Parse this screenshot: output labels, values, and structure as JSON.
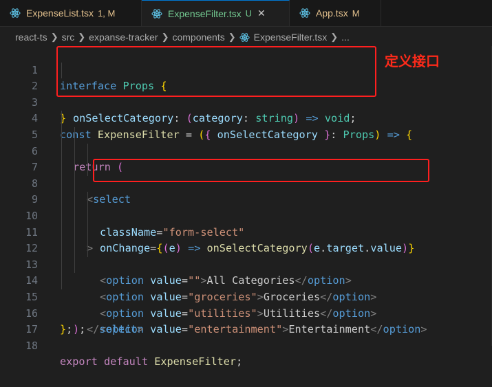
{
  "tabs": [
    {
      "name": "ExpenseList.tsx",
      "status": "1, M"
    },
    {
      "name": "ExpenseFilter.tsx",
      "status": "U",
      "close": "✕"
    },
    {
      "name": "App.tsx",
      "status": "M"
    }
  ],
  "breadcrumb": {
    "parts": [
      "react-ts",
      "src",
      "expanse-tracker",
      "components",
      "ExpenseFilter.tsx",
      "..."
    ]
  },
  "annotation": {
    "text": "定义接口"
  },
  "line_numbers": [
    "1",
    "2",
    "3",
    "4",
    "5",
    "6",
    "7",
    "8",
    "9",
    "10",
    "11",
    "12",
    "13",
    "14",
    "15",
    "16",
    "17",
    "18"
  ],
  "code": {
    "l1": {
      "kw": "interface",
      "name": "Props",
      "brace": "{"
    },
    "l2": {
      "prop": "onSelectCategory",
      "colon": ": ",
      "open": "(",
      "param": "category",
      "colon2": ": ",
      "type": "string",
      "close": ")",
      "arrow": " => ",
      "ret": "void",
      "semi": ";"
    },
    "l3": {
      "brace": "}"
    },
    "l4": {
      "kw": "const",
      "name": "ExpenseFilter",
      "eq": " = ",
      "open": "(",
      "lb": "{ ",
      "param": "onSelectCategory",
      "rb": " }",
      "colon": ": ",
      "type": "Props",
      "close": ")",
      "arrow": " => ",
      "brace": "{"
    },
    "l5": {
      "kw": "return",
      "paren": "("
    },
    "l6": {
      "lt": "<",
      "tag": "select"
    },
    "l7": {
      "attr": "className",
      "eq": "=",
      "val": "\"form-select\""
    },
    "l8": {
      "attr": "onChange",
      "eq": "=",
      "lb": "{",
      "open": "(",
      "param": "e",
      "close": ")",
      "arrow": " => ",
      "fn": "onSelectCategory",
      "open2": "(",
      "obj": "e",
      "dot": ".",
      "prop": "target",
      "dot2": ".",
      "prop2": "value",
      "close2": ")",
      "rb": "}"
    },
    "l9": {
      "gt": ">"
    },
    "l10": {
      "tag": "option",
      "attr": "value",
      "val": "\"\"",
      "text": "All Categories"
    },
    "l11": {
      "tag": "option",
      "attr": "value",
      "val": "\"groceries\"",
      "text": "Groceries"
    },
    "l12": {
      "tag": "option",
      "attr": "value",
      "val": "\"utilities\"",
      "text": "Utilities"
    },
    "l13": {
      "tag": "option",
      "attr": "value",
      "val": "\"entertainment\"",
      "text": "Entertainment"
    },
    "l14": {
      "tag": "select"
    },
    "l15": {
      "paren": ")",
      "semi": ";"
    },
    "l16": {
      "brace": "}",
      "semi": ";"
    },
    "l18": {
      "kw1": "export",
      "kw2": "default",
      "name": "ExpenseFilter",
      "semi": ";"
    }
  },
  "colors": {
    "highlight_box": "#ff1f1f",
    "background": "#1f1f1f",
    "tab_modified": "#e2c08d",
    "tab_untracked": "#73c991"
  }
}
